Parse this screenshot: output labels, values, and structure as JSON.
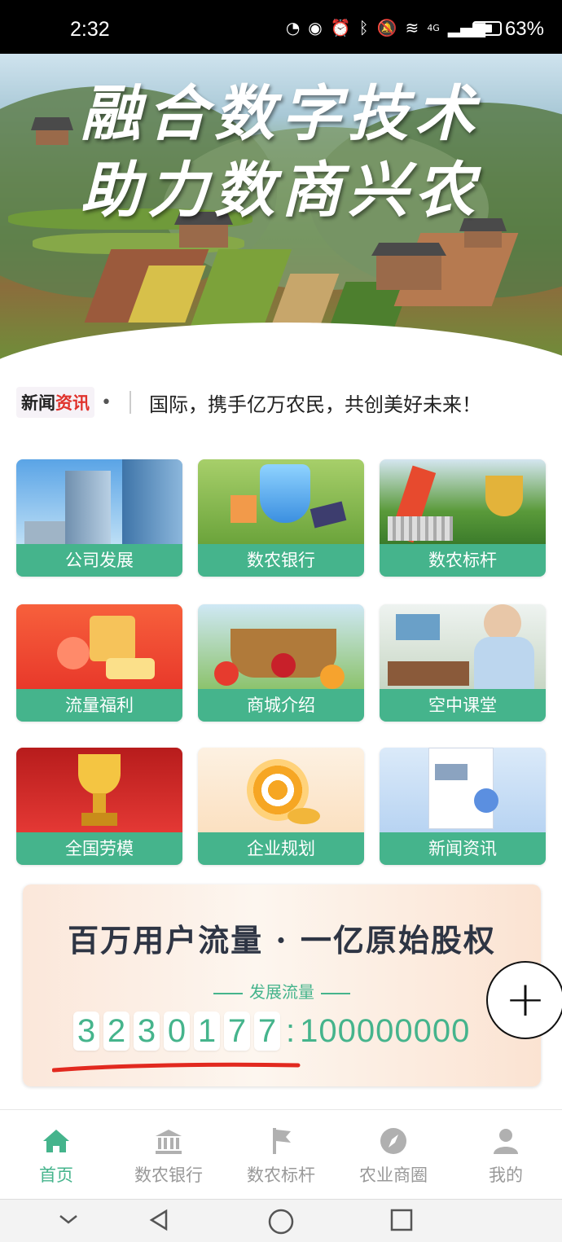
{
  "status_bar": {
    "time": "2:32",
    "battery_percent": "63%",
    "network_label": "4G",
    "icons": [
      "speed-icon",
      "eye-icon",
      "alarm-icon",
      "bluetooth-icon",
      "mute-icon",
      "wifi-icon",
      "signal-icon",
      "battery-icon"
    ]
  },
  "hero": {
    "line1": "融合数字技术",
    "line2": "助力数商兴农"
  },
  "ticker": {
    "logo_part1": "新闻",
    "logo_part2": "资讯",
    "dot": "•",
    "text": "国际，携手亿万农民，共创美好未来！"
  },
  "grid": {
    "items": [
      {
        "label": "公司发展",
        "icon": "building-image"
      },
      {
        "label": "数农银行",
        "icon": "bank-shield-image"
      },
      {
        "label": "数农标杆",
        "icon": "trophy-arrow-image"
      },
      {
        "label": "流量福利",
        "icon": "gift-image"
      },
      {
        "label": "商城介绍",
        "icon": "produce-basket-image"
      },
      {
        "label": "空中课堂",
        "icon": "classroom-image"
      },
      {
        "label": "全国劳模",
        "icon": "gold-cup-image"
      },
      {
        "label": "企业规划",
        "icon": "target-image"
      },
      {
        "label": "新闻资讯",
        "icon": "news-image"
      }
    ]
  },
  "promo": {
    "headline": "百万用户流量 · 一亿原始股权",
    "subtitle": "发展流量",
    "digits": [
      "3",
      "2",
      "3",
      "0",
      "1",
      "7",
      "7"
    ],
    "separator": ":",
    "total": "100000000"
  },
  "fab": {
    "label": "+"
  },
  "bottom_nav": {
    "items": [
      {
        "label": "首页",
        "icon": "home-icon",
        "active": true
      },
      {
        "label": "数农银行",
        "icon": "bank-icon",
        "active": false
      },
      {
        "label": "数农标杆",
        "icon": "flag-icon",
        "active": false
      },
      {
        "label": "农业商圈",
        "icon": "compass-icon",
        "active": false
      },
      {
        "label": "我的",
        "icon": "user-icon",
        "active": false
      }
    ]
  },
  "colors": {
    "accent": "#45b48c",
    "ticker_red": "#e0322c",
    "headline": "#2e3544"
  }
}
